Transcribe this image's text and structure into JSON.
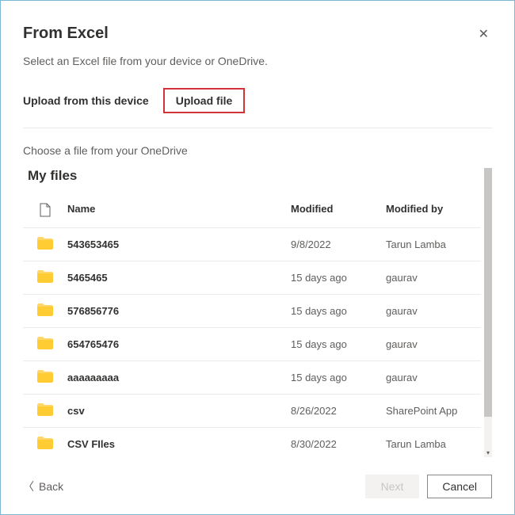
{
  "dialog": {
    "title": "From Excel",
    "subtitle": "Select an Excel file from your device or OneDrive.",
    "upload_label": "Upload from this device",
    "upload_file_btn": "Upload file",
    "choose_label": "Choose a file from your OneDrive",
    "myfiles": "My files"
  },
  "columns": {
    "name": "Name",
    "modified": "Modified",
    "modified_by": "Modified by"
  },
  "files": [
    {
      "name": "543653465",
      "modified": "9/8/2022",
      "by": "Tarun Lamba"
    },
    {
      "name": "5465465",
      "modified": "15 days ago",
      "by": "gaurav"
    },
    {
      "name": "576856776",
      "modified": "15 days ago",
      "by": "gaurav"
    },
    {
      "name": "654765476",
      "modified": "15 days ago",
      "by": "gaurav"
    },
    {
      "name": "aaaaaaaaa",
      "modified": "15 days ago",
      "by": "gaurav"
    },
    {
      "name": "csv",
      "modified": "8/26/2022",
      "by": "SharePoint App"
    },
    {
      "name": "CSV FIles",
      "modified": "8/30/2022",
      "by": "Tarun Lamba"
    }
  ],
  "footer": {
    "back": "Back",
    "next": "Next",
    "cancel": "Cancel"
  }
}
